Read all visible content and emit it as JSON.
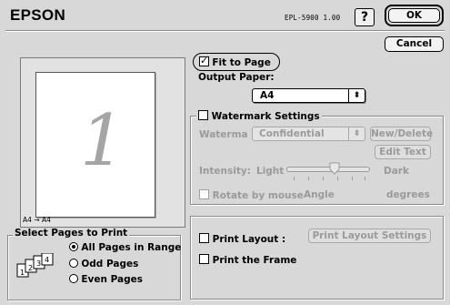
{
  "header": {
    "brand": "EPSON",
    "model": "EPL-5900 1.00",
    "help_label": "?",
    "ok_label": "OK",
    "cancel_label": "Cancel"
  },
  "preview": {
    "page_number": "1",
    "size_mapping": "A4 → A4"
  },
  "select_pages": {
    "title": "Select Pages to Print",
    "options": [
      "All Pages in Range",
      "Odd Pages",
      "Even Pages"
    ],
    "selected": "All Pages in Range"
  },
  "fit_to_page": {
    "label": "Fit to Page",
    "checked": true,
    "output_paper_label": "Output Paper:",
    "output_paper_value": "A4"
  },
  "watermark": {
    "label": "Watermark Settings",
    "checked": false,
    "name_label": "Waterma",
    "name_value": "Confidential",
    "new_delete_label": "New/Delete",
    "edit_text_label": "Edit Text",
    "intensity_label": "Intensity:",
    "light_label": "Light",
    "dark_label": "Dark",
    "intensity_level": 0.5,
    "rotate_label": "Rotate by mouse",
    "angle_label": "Angle",
    "degrees_label": "degrees"
  },
  "layout": {
    "print_layout_label": "Print Layout :",
    "print_layout_settings_label": "Print Layout Settings",
    "print_frame_label": "Print the Frame"
  },
  "icons": [
    "help-icon",
    "popup-arrows-icon",
    "stacked-pages-icon",
    "checkmark-icon"
  ]
}
